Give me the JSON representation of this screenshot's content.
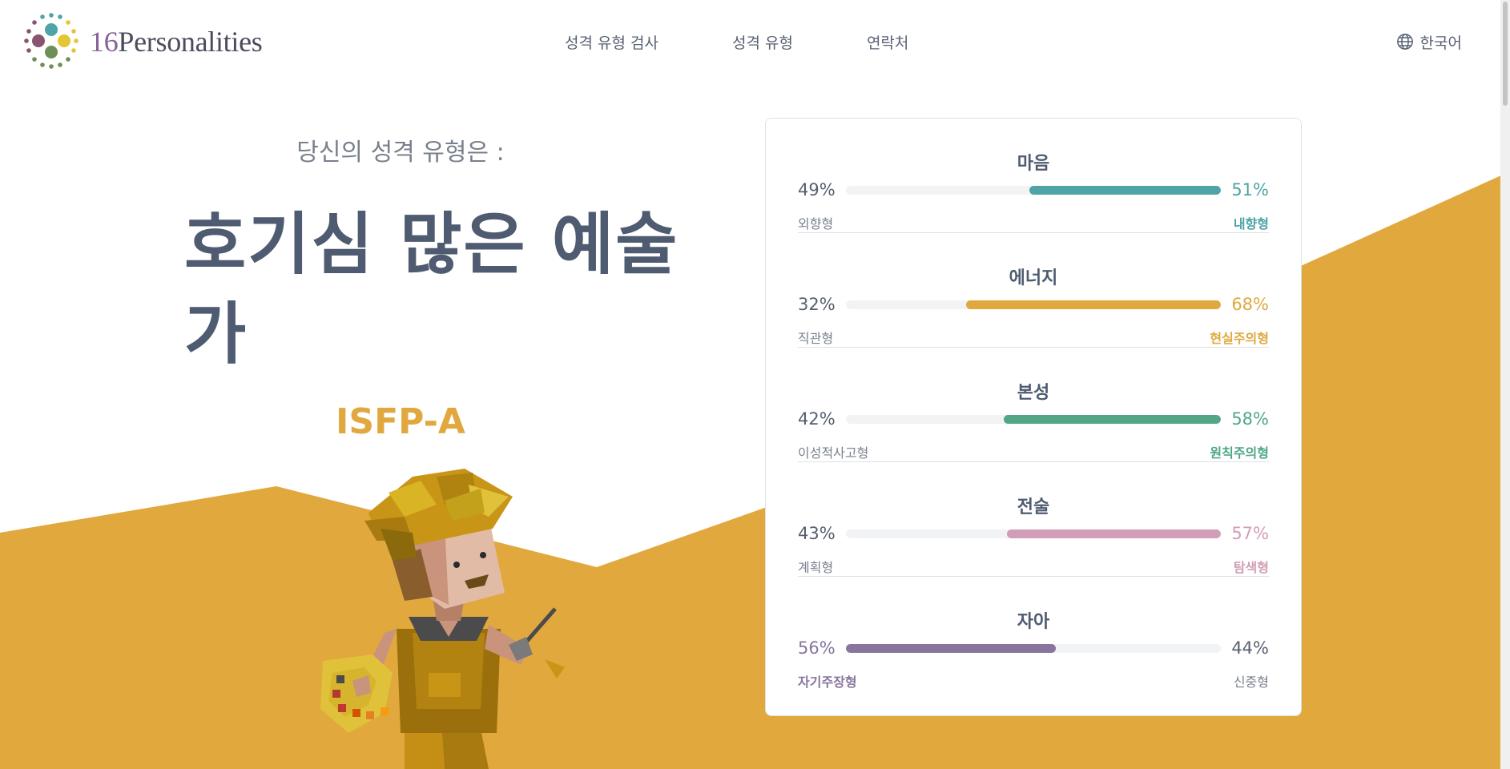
{
  "brand": {
    "name": "16Personalities",
    "num": "16",
    "rest": "Personalities"
  },
  "nav": {
    "items": [
      {
        "label": "성격 유형 검사"
      },
      {
        "label": "성격 유형"
      },
      {
        "label": "연락처"
      }
    ],
    "language": "한국어"
  },
  "hero": {
    "subtitle": "당신의 성격 유형은 :",
    "title": "호기심 많은 예술가",
    "code": "ISFP-A"
  },
  "colors": {
    "background_band": "#e1a83e",
    "teal": "#4ea4a6",
    "yellow": "#e0a83f",
    "green": "#4fa785",
    "pink": "#d29db6",
    "purple": "#88759d"
  },
  "traits": [
    {
      "title": "마음",
      "left_pct": "49%",
      "right_pct": "51%",
      "left_label": "외향형",
      "right_label": "내향형",
      "dominant": "right",
      "dominant_value": 51,
      "color": "#4ea4a6"
    },
    {
      "title": "에너지",
      "left_pct": "32%",
      "right_pct": "68%",
      "left_label": "직관형",
      "right_label": "현실주의형",
      "dominant": "right",
      "dominant_value": 68,
      "color": "#e0a83f"
    },
    {
      "title": "본성",
      "left_pct": "42%",
      "right_pct": "58%",
      "left_label": "이성적사고형",
      "right_label": "원칙주의형",
      "dominant": "right",
      "dominant_value": 58,
      "color": "#4fa785"
    },
    {
      "title": "전술",
      "left_pct": "43%",
      "right_pct": "57%",
      "left_label": "계획형",
      "right_label": "탐색형",
      "dominant": "right",
      "dominant_value": 57,
      "color": "#d29db6"
    },
    {
      "title": "자아",
      "left_pct": "56%",
      "right_pct": "44%",
      "left_label": "자기주장형",
      "right_label": "신중형",
      "dominant": "left",
      "dominant_value": 56,
      "color": "#88759d"
    }
  ]
}
